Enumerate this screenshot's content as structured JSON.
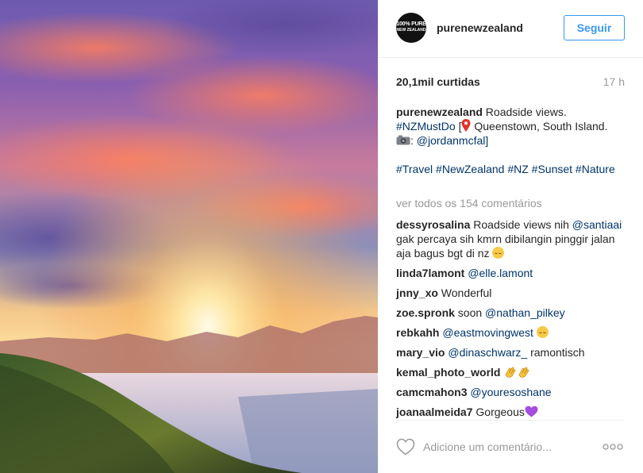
{
  "account": {
    "username": "purenewzealand",
    "avatar_line1": "100% PURE",
    "avatar_line2": "NEW ZEALAND",
    "follow_label": "Seguir"
  },
  "stats": {
    "likes": "20,1mil curtidas",
    "time": "17 h"
  },
  "caption": {
    "username": "purenewzealand",
    "text1": " Roadside views.",
    "tag1": "#NZMustDo",
    "text2": " [",
    "location": " Queenstown, South Island.",
    "text3": ": ",
    "mention": "@jordanmcfal",
    "text4": "]",
    "hashtags": "#Travel #NewZealand #NZ #Sunset #Nature"
  },
  "view_all_comments": "ver todos os 154 comentários",
  "comments": [
    {
      "user": "dessyrosalina",
      "text": " Roadside views nih ",
      "mention": "@santiaai",
      "text2": " gak percaya sih kmrn dibilangin pinggir jalan aja bagus bgt di nz ",
      "emoji": "relieved"
    },
    {
      "user": "linda7lamont",
      "text": " ",
      "mention": "@elle.lamont",
      "text2": "",
      "emoji": ""
    },
    {
      "user": "jnny_xo",
      "text": " Wonderful",
      "mention": "",
      "text2": "",
      "emoji": ""
    },
    {
      "user": "zoe.spronk",
      "text": " soon ",
      "mention": "@nathan_pilkey",
      "text2": "",
      "emoji": ""
    },
    {
      "user": "rebkahh",
      "text": " ",
      "mention": "@eastmovingwest",
      "text2": " ",
      "emoji": "relieved"
    },
    {
      "user": "mary_vio",
      "text": " ",
      "mention": "@dinaschwarz_",
      "text2": " ramontisch",
      "emoji": ""
    },
    {
      "user": "kemal_photo_world",
      "text": " ",
      "mention": "",
      "text2": "",
      "emoji": "clap"
    },
    {
      "user": "camcmahon3",
      "text": " ",
      "mention": "@youresoshane",
      "text2": "",
      "emoji": ""
    },
    {
      "user": "joanaalmeida7",
      "text": " Gorgeous",
      "mention": "",
      "text2": "",
      "emoji": "purple-heart"
    }
  ],
  "footer": {
    "comment_placeholder": "Adicione um comentário..."
  },
  "icons": {
    "like": "heart-outline-icon",
    "more": "more-dots-icon",
    "location": "pin-icon",
    "camera": "camera-icon"
  },
  "colors": {
    "link": "#003569",
    "follow_blue": "#3897f0",
    "muted": "#999999",
    "text": "#262626"
  }
}
